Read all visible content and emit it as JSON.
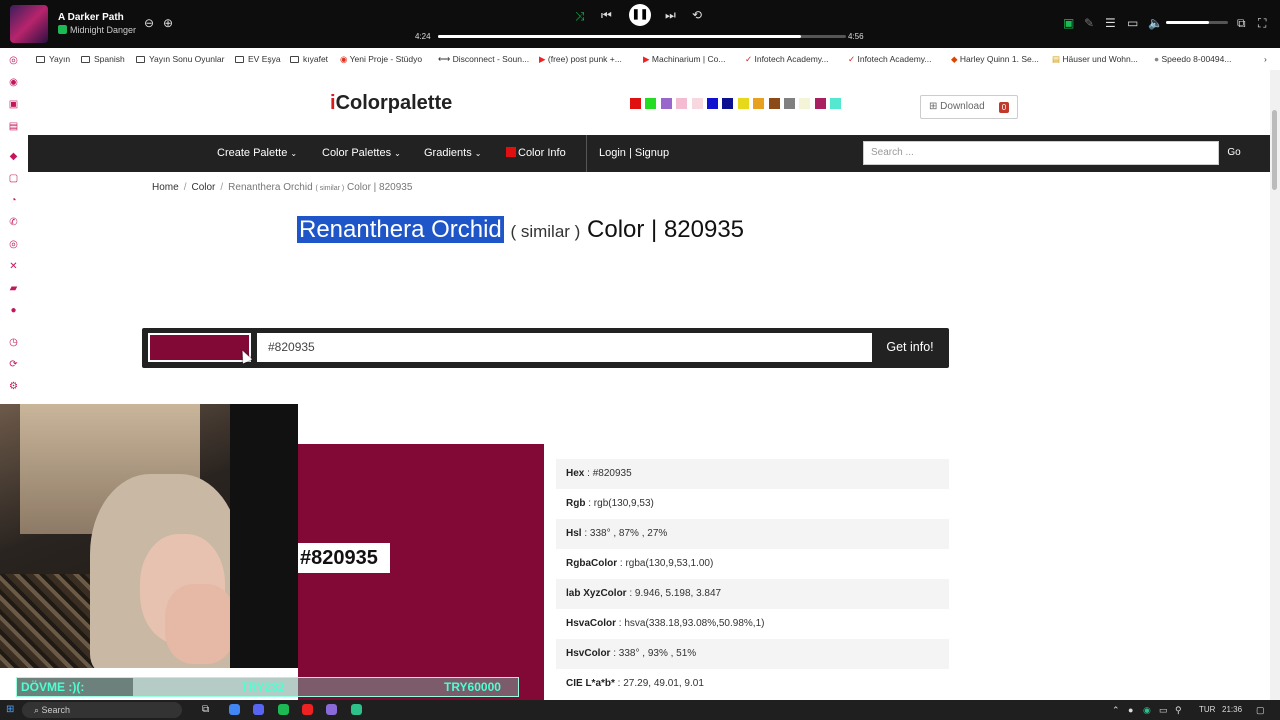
{
  "player": {
    "song_title": "A Darker Path",
    "artist": "Midnight Danger",
    "time_current": "4:24",
    "time_total": "4:56",
    "progress_fraction": 0.89,
    "volume_fraction": 0.7
  },
  "bookmarks": [
    "Yayın",
    "Spanish",
    "Yayın Sonu Oyunlar",
    "EV Eşya",
    "kıyafet",
    "Yeni Proje - Stüdyo",
    "Disconnect - Soun...",
    "(free) post punk +...",
    "Machinarium | Co...",
    "Infotech Academy...",
    "Infotech Academy...",
    "Harley Quinn 1. Se...",
    "Häuser und Wohn...",
    "Speedo 8-00494..."
  ],
  "site": {
    "logo_first": "i",
    "logo_rest": "Colorpalette",
    "swatch_colors": [
      "#e01010",
      "#22dd22",
      "#9966cc",
      "#f4bcd0",
      "#f8d8e0",
      "#1010d0",
      "#0a1090",
      "#e8d81a",
      "#e8a020",
      "#8b4a18",
      "#808080",
      "#f4f4d8",
      "#a82060",
      "#55e8d0"
    ],
    "download_label": "Download",
    "download_count": "0"
  },
  "nav": {
    "create_palette": "Create Palette",
    "color_palettes": "Color Palettes",
    "gradients": "Gradients",
    "color_info": "Color Info",
    "login": "Login | Signup",
    "search_placeholder": "Search ...",
    "go": "Go"
  },
  "breadcrumb": {
    "home": "Home",
    "color": "Color",
    "current_name": "Renanthera Orchid",
    "current_similar": "( similar )",
    "current_rest": "Color | 820935"
  },
  "heading": {
    "name": "Renanthera Orchid",
    "similar": "( similar )",
    "rest": "Color | 820935"
  },
  "color_input": {
    "swatch_color": "#820935",
    "value": "#820935",
    "button": "Get info!"
  },
  "preview": {
    "hex_label": "#820935"
  },
  "info": [
    {
      "key": "Hex",
      "value": "#820935"
    },
    {
      "key": "Rgb",
      "value": "rgb(130,9,53)"
    },
    {
      "key": "Hsl",
      "value": "338° , 87% , 27%"
    },
    {
      "key": "RgbaColor",
      "value": "rgba(130,9,53,1.00)"
    },
    {
      "key": "lab XyzColor",
      "value": "9.946, 5.198, 3.847"
    },
    {
      "key": "HsvaColor",
      "value": "hsva(338.18,93.08%,50.98%,1)"
    },
    {
      "key": "HsvColor",
      "value": "338° , 93% , 51%"
    },
    {
      "key": "CIE L*a*b*",
      "value": "27.29, 49.01, 9.01"
    }
  ],
  "stream": {
    "goal_text": "DÖVME :)(:",
    "goal_current": "TRY232",
    "goal_target": "TRY60000"
  },
  "taskbar": {
    "search": "Search",
    "lang": "TUR",
    "time": "21:36"
  }
}
